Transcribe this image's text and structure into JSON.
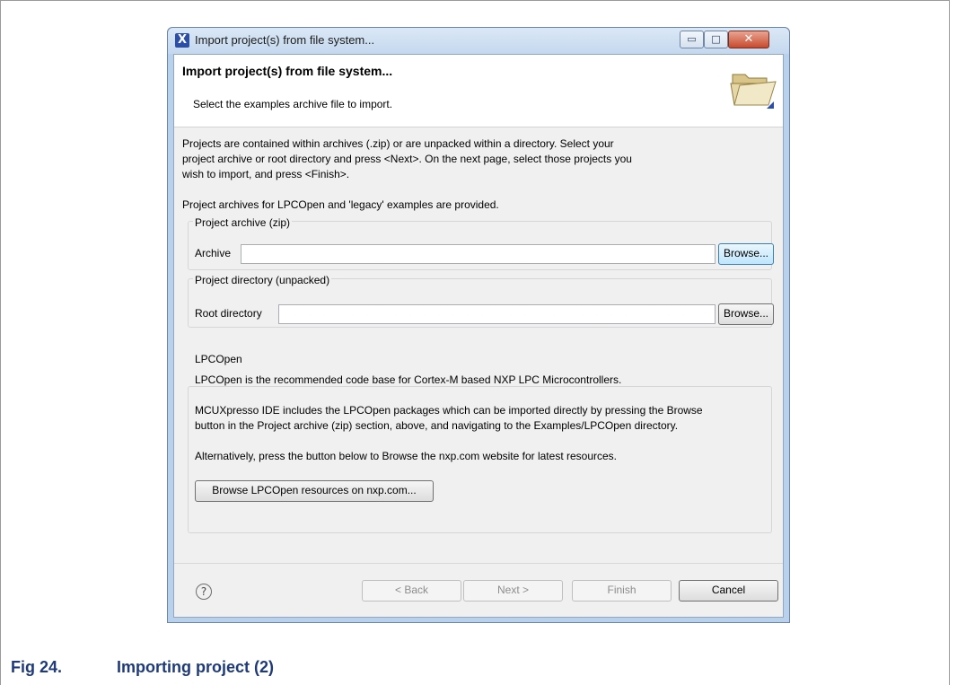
{
  "window": {
    "title": "Import project(s) from file system...",
    "minimize_glyph": "▭",
    "maximize_glyph": "□",
    "close_glyph": "✕",
    "app_icon_glyph": "X"
  },
  "banner": {
    "title": "Import project(s) from file system...",
    "subtitle": "Select the examples archive file to import."
  },
  "intro": {
    "line1": "Projects are contained within archives (.zip) or are unpacked within a directory. Select your",
    "line2": "project archive or root directory and press <Next>. On the next page, select those projects you",
    "line3": "wish to import, and press <Finish>.",
    "provided": "Project archives for LPCOpen and 'legacy' examples are provided."
  },
  "archive_group": {
    "label": "Project archive (zip)",
    "field_label": "Archive",
    "value": "",
    "browse_label": "Browse..."
  },
  "directory_group": {
    "label": "Project directory (unpacked)",
    "field_label": "Root directory",
    "value": "",
    "browse_label": "Browse..."
  },
  "lpcopen_group": {
    "label": "LPCOpen",
    "text1": "LPCOpen is the recommended code base for Cortex-M based NXP LPC Microcontrollers.",
    "text2a": "MCUXpresso IDE includes the LPCOpen packages which can be imported directly by pressing the Browse",
    "text2b": "button in the Project archive (zip) section, above, and navigating to the Examples/LPCOpen directory.",
    "text3": "Alternatively, press the button below to Browse the nxp.com website for latest resources.",
    "button_label": "Browse LPCOpen resources on nxp.com..."
  },
  "footer": {
    "help_glyph": "?",
    "back_label": "< Back",
    "next_label": "Next >",
    "finish_label": "Finish",
    "cancel_label": "Cancel"
  },
  "caption": {
    "number": "Fig 24.",
    "text": "Importing project (2)"
  },
  "colors": {
    "caption": "#1f3a7a",
    "window_frame": "#b9d1ea",
    "close_button": "#c74a2c"
  }
}
